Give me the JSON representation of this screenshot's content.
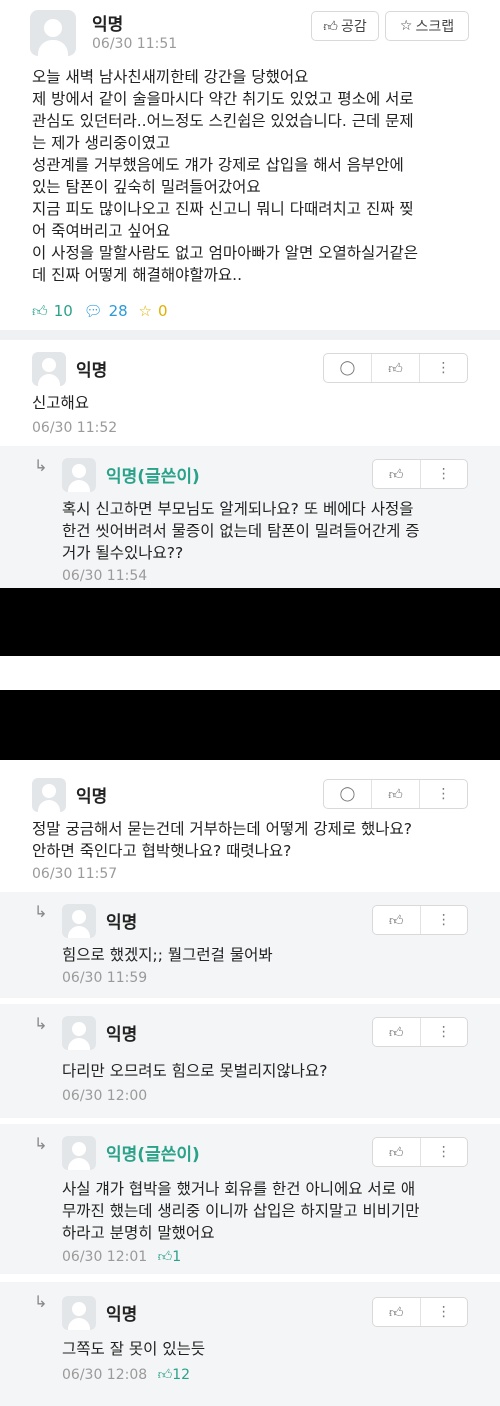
{
  "post": {
    "author": "익명",
    "time": "06/30 11:51",
    "like_button": "공감",
    "scrap_button": "스크랩",
    "body": "오늘 새벽 남사친새끼한테 강간을 당했어요\n제 방에서 같이 술을마시다 약간 취기도 있었고 평소에 서로\n관심도 있던터라..어느정도 스킨쉽은 있었습니다. 근데 문제\n는 제가 생리중이였고\n성관계를 거부했음에도 걔가 강제로 삽입을 해서 음부안에\n있는 탐폰이 깊숙히 밀려들어갔어요\n지금 피도 많이나오고  진짜 신고니 뭐니 다때려치고 진짜 찢\n어 죽여버리고 싶어요\n이 사정을 말할사람도 없고 엄마아빠가 알면 오열하실거같은\n데 진짜 어떻게 해결해야할까요..",
    "likes": "10",
    "comments": "28",
    "scraps": "0"
  },
  "comments": [
    {
      "author": "익명",
      "text": "신고해요",
      "time": "06/30 11:52"
    },
    {
      "author": "익명(글쓴이)",
      "text": "혹시 신고하면 부모님도 알게되나요? 또 베에다 사정을\n한건 씻어버려서 물증이 없는데 탐폰이 밀려들어간게 증\n거가 될수있나요??",
      "time": "06/30 11:54"
    },
    {
      "author": "익명",
      "text": "정말 궁금해서 묻는건데 거부하는데 어떻게 강제로 했나요?\n안하면 죽인다고 협박햇나요? 때렷나요?",
      "time": "06/30 11:57"
    },
    {
      "author": "익명",
      "text": "힘으로 했겠지;; 뭘그런걸 물어봐",
      "time": "06/30 11:59"
    },
    {
      "author": "익명",
      "text": "다리만 오므려도 힘으로 못벌리지않나요?",
      "time": "06/30 12:00"
    },
    {
      "author": "익명(글쓴이)",
      "text": "사실 걔가 협박을 했거나 회유를 한건 아니에요 서로 애\n무까진 했는데 생리중 이니까 삽입은 하지말고 비비기만\n하라고 분명히 말했어요",
      "time": "06/30 12:01",
      "likes": "1"
    },
    {
      "author": "익명",
      "text": "그쪽도 잘 못이 있는듯",
      "time": "06/30 12:08",
      "likes": "12"
    }
  ],
  "colors": {
    "op_name": "#2aa28a",
    "like_count": "#2aa28a",
    "comment_count": "#2d9ad8",
    "scrap_count": "#e0b000"
  }
}
